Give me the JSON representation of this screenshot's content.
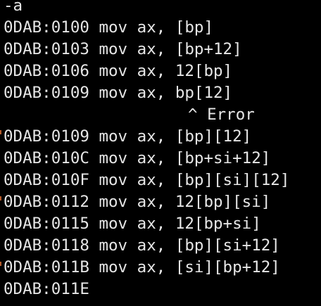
{
  "theme": {
    "background": "#000000",
    "text": "#e6e6e6",
    "left_marker": "#b55a2a"
  },
  "terminal": {
    "lines": [
      "-a",
      "0DAB:0100 mov ax, [bp]",
      "0DAB:0103 mov ax, [bp+12]",
      "0DAB:0106 mov ax, 12[bp]",
      "0DAB:0109 mov ax, bp[12]",
      "^ Error",
      "0DAB:0109 mov ax, [bp][12]",
      "0DAB:010C mov ax, [bp+si+12]",
      "0DAB:010F mov ax, [bp][si][12]",
      "0DAB:0112 mov ax, 12[bp][si]",
      "0DAB:0115 mov ax, 12[bp+si]",
      "0DAB:0118 mov ax, [bp][si+12]",
      "0DAB:011B mov ax, [si][bp+12]",
      "0DAB:011E"
    ]
  }
}
